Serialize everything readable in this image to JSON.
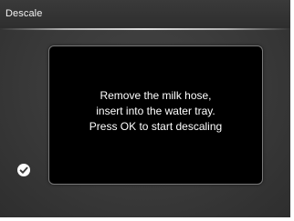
{
  "header": {
    "title": "Descale"
  },
  "dialog": {
    "message_lines": [
      "Remove the milk hose,",
      "insert into the water tray.",
      "Press OK to start descaling"
    ]
  },
  "controls": {
    "confirm_icon": "checkmark-icon"
  },
  "colors": {
    "background": "#393939",
    "panel": "#000000",
    "text": "#ffffff"
  }
}
